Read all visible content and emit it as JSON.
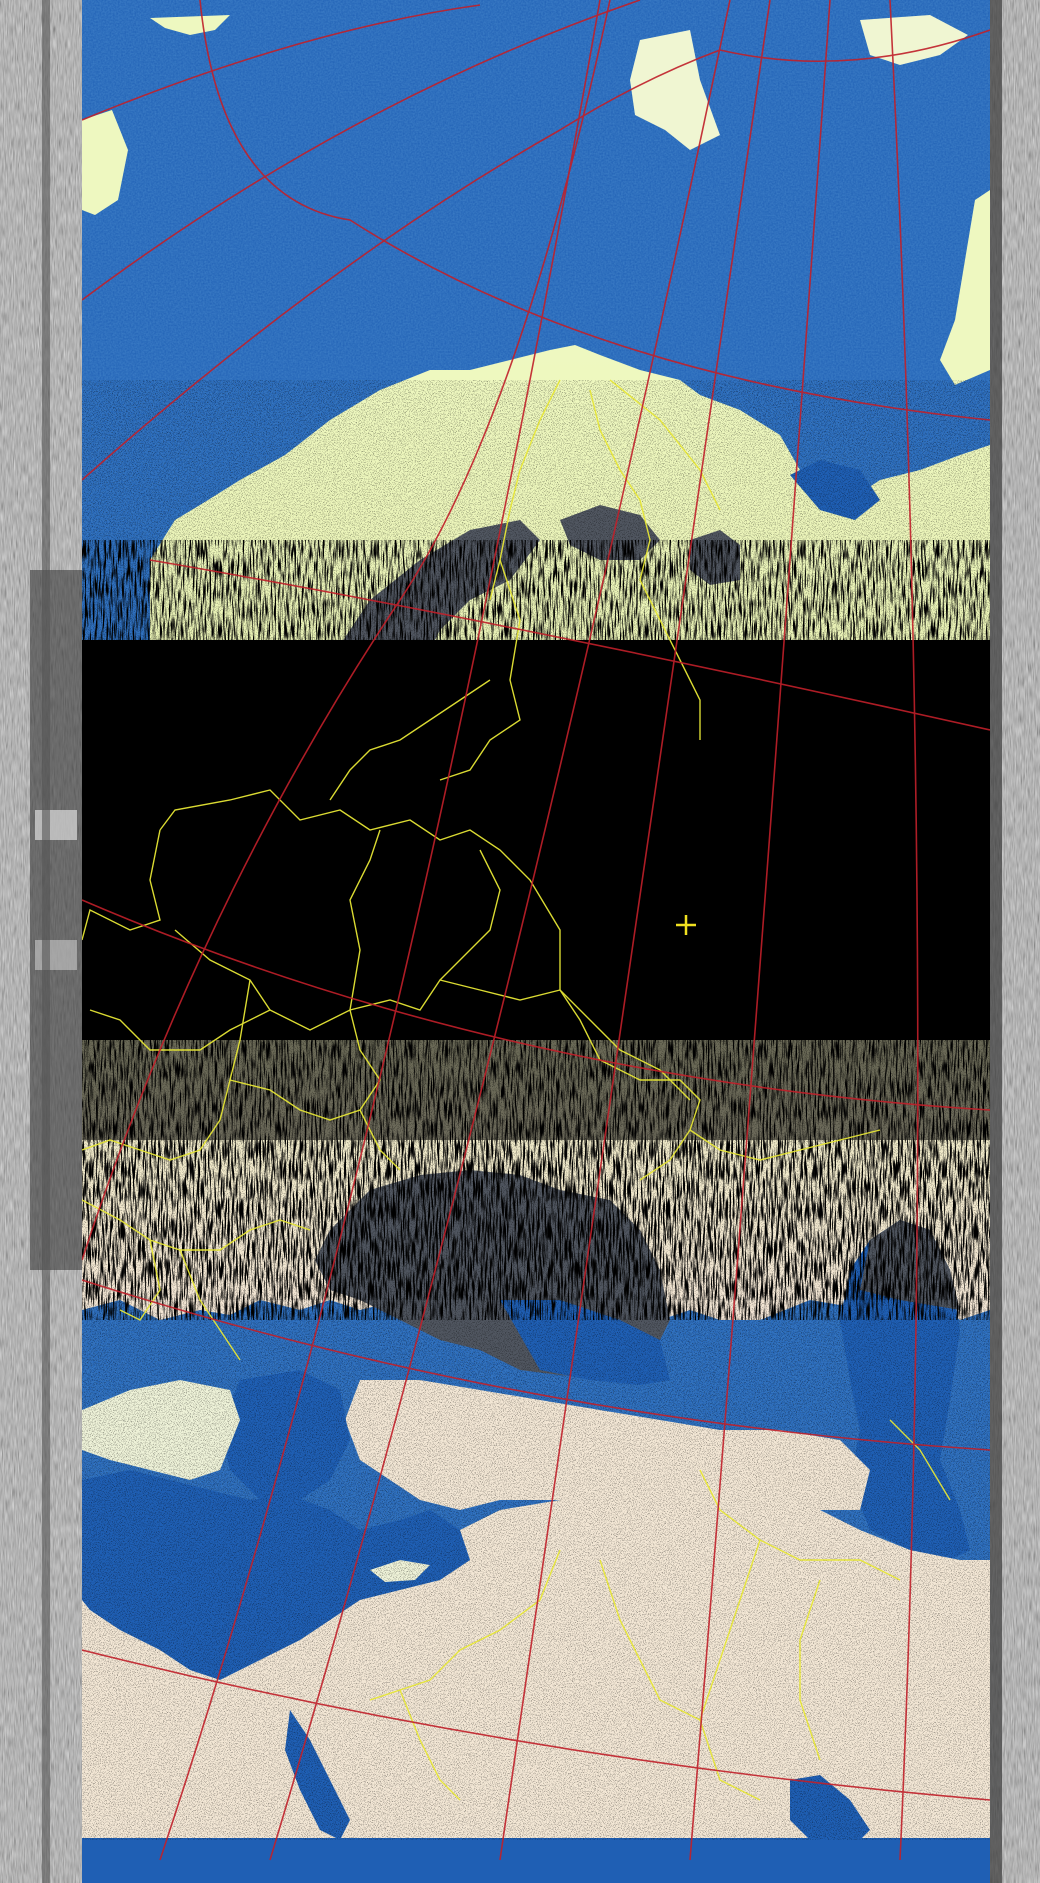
{
  "image": {
    "kind": "satellite-weather-image",
    "palette": {
      "sea": "#1f5fb4",
      "sea_noise": "#3a7fd8",
      "cold_land": "#eaf4b8",
      "desert": "#f3e7d5",
      "cloud_gap": "#000000",
      "grid_lines": "#c0202a",
      "borders": "#e6e635",
      "coast_overlay": "#8fcf6e",
      "noise_gray": "#707070"
    },
    "marker": {
      "symbol": "+",
      "color": "#f0e020"
    }
  }
}
